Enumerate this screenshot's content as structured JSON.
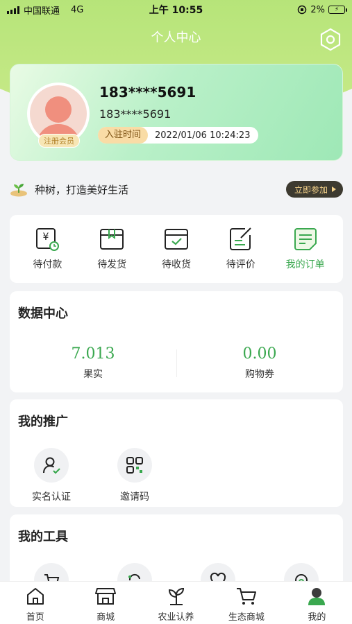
{
  "status_bar": {
    "carrier": "中国联通",
    "network": "4G",
    "time": "上午 10:55",
    "battery": "2%"
  },
  "header": {
    "title": "个人中心"
  },
  "profile": {
    "name": "183****5691",
    "phone": "183****5691",
    "member_badge": "注册会员",
    "join_label": "入驻时间",
    "join_time": "2022/01/06 10:24:23"
  },
  "tree_banner": {
    "text": "种树，打造美好生活",
    "button": "立即参加"
  },
  "orders": [
    {
      "label": "待付款",
      "icon": "pending-payment-icon"
    },
    {
      "label": "待发货",
      "icon": "pending-shipment-icon"
    },
    {
      "label": "待收货",
      "icon": "pending-receipt-icon"
    },
    {
      "label": "待评价",
      "icon": "pending-review-icon"
    },
    {
      "label": "我的订单",
      "icon": "my-orders-icon"
    }
  ],
  "data_center": {
    "title": "数据中心",
    "fruit": {
      "value": "7.013",
      "label": "果实"
    },
    "voucher": {
      "value": "0.00",
      "label": "购物券"
    }
  },
  "promotion": {
    "title": "我的推广",
    "items": [
      {
        "label": "实名认证",
        "icon": "verified-user-icon"
      },
      {
        "label": "邀请码",
        "icon": "qr-code-icon"
      }
    ]
  },
  "tools": {
    "title": "我的工具"
  },
  "tabbar": [
    {
      "label": "首页",
      "icon": "home-icon"
    },
    {
      "label": "商城",
      "icon": "store-icon"
    },
    {
      "label": "农业认养",
      "icon": "plant-icon"
    },
    {
      "label": "生态商城",
      "icon": "cart-icon"
    },
    {
      "label": "我的",
      "icon": "user-icon"
    }
  ],
  "colors": {
    "accent": "#3aa84f",
    "header_green": "#7ed957"
  }
}
